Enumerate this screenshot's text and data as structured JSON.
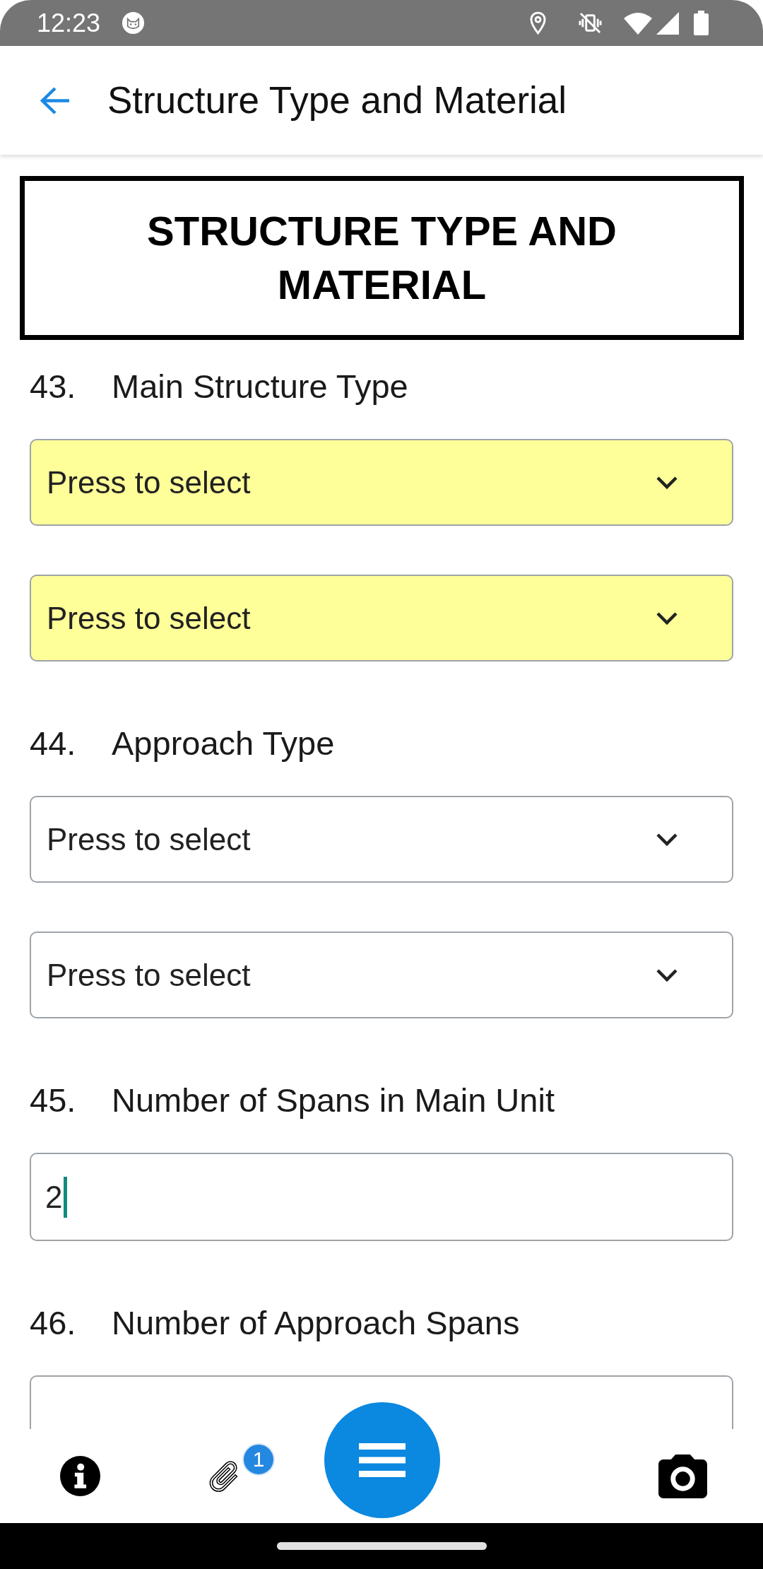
{
  "status_bar": {
    "time": "12:23"
  },
  "app_bar": {
    "title": "Structure Type and Material"
  },
  "section_title": "STRUCTURE TYPE AND MATERIAL",
  "questions": [
    {
      "number": "43.",
      "label": "Main Structure Type",
      "controls": [
        {
          "kind": "dropdown",
          "placeholder": "Press to select",
          "highlighted": true
        },
        {
          "kind": "dropdown",
          "placeholder": "Press to select",
          "highlighted": true
        }
      ]
    },
    {
      "number": "44.",
      "label": "Approach Type",
      "controls": [
        {
          "kind": "dropdown",
          "placeholder": "Press to select",
          "highlighted": false
        },
        {
          "kind": "dropdown",
          "placeholder": "Press to select",
          "highlighted": false
        }
      ]
    },
    {
      "number": "45.",
      "label": "Number of Spans in Main Unit",
      "controls": [
        {
          "kind": "text_input",
          "value": "2",
          "focused": true
        }
      ]
    },
    {
      "number": "46.",
      "label": "Number of Approach Spans",
      "controls": [
        {
          "kind": "text_input",
          "focused": false
        }
      ]
    }
  ],
  "bottom_bar": {
    "attachment_badge": "1"
  }
}
